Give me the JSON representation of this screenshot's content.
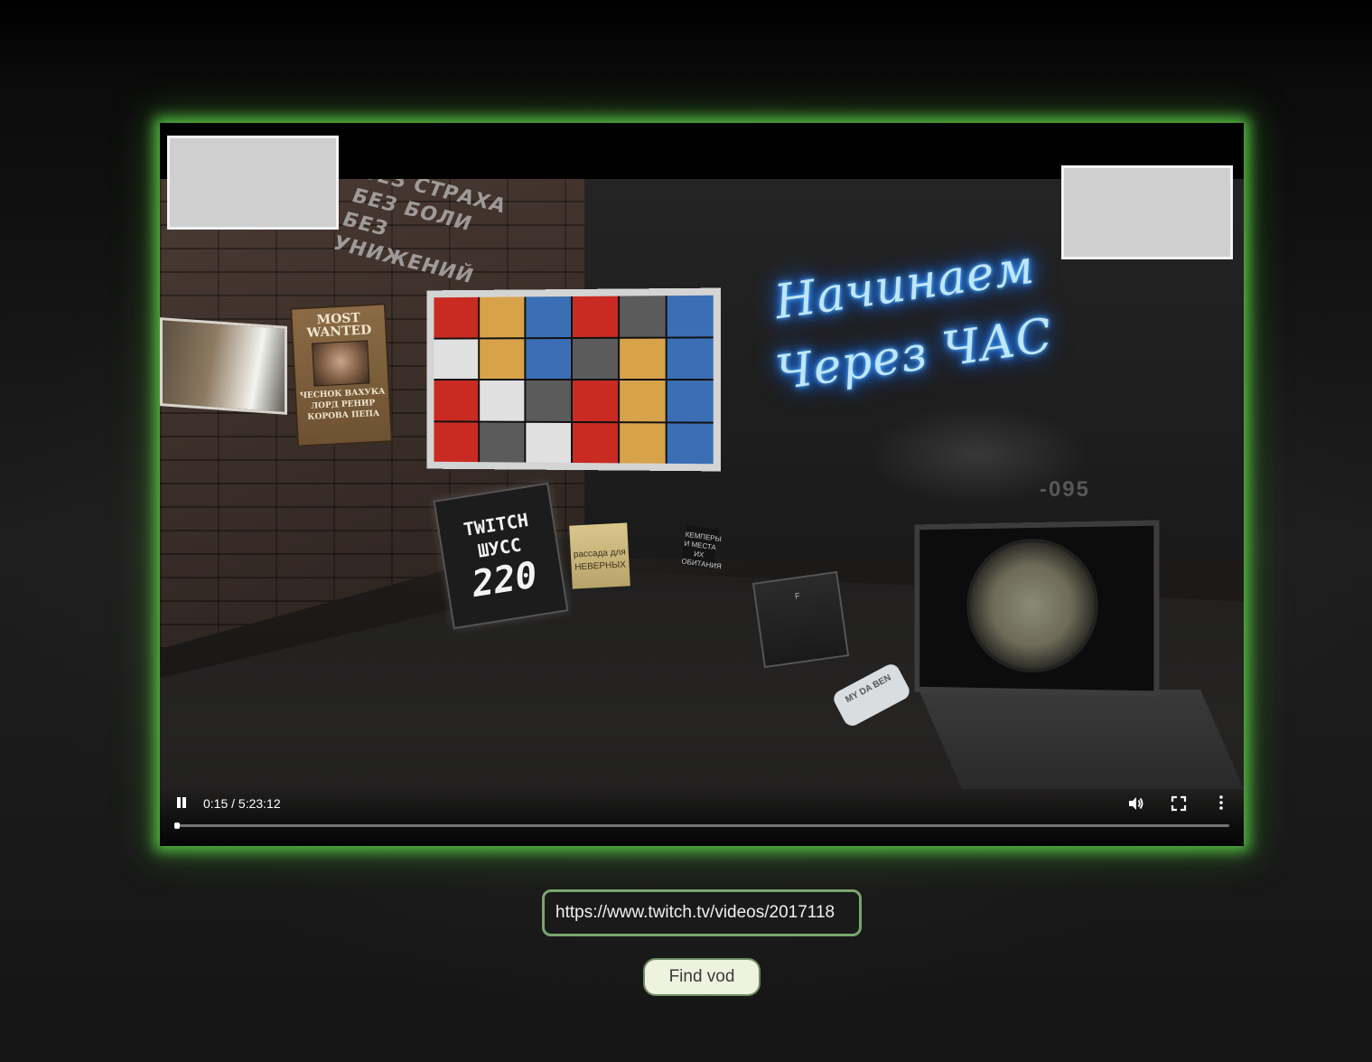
{
  "video": {
    "scene": {
      "graffiti_lines": [
        "БЕЗ СТРАХА",
        "БЕЗ БОЛИ",
        "БЕЗ УНИЖЕНИЙ"
      ],
      "wanted_poster": {
        "title_line1": "MOST",
        "title_line2": "WANTED",
        "name_line1": "ЧЕСНОК ВАХУКА",
        "name_line2": "ЛОРД РЕНИР",
        "name_line3": "КОРОВА ПЕПА"
      },
      "neon_sign": {
        "line1": "Начинаем",
        "line2": "Через ЧАС"
      },
      "twitch_box": {
        "line1": "TWITCH",
        "line2": "ШУСС",
        "line3": "220"
      },
      "crate_label": "рассада для НЕВЕРНЫХ",
      "small_sign": "КЕМПЕРЫ И МЕСТА ИХ ОБИТАНИЯ",
      "wolf_plate": "-095",
      "dog_tag": "MY DA BEN",
      "photo_card": "F"
    },
    "controls": {
      "play_state": "playing",
      "play_pause_icon": "pause-icon",
      "time_display": "0:15 / 5:23:12",
      "volume_icon": "volume-icon",
      "fullscreen_icon": "fullscreen-icon",
      "more_icon": "more-vert-icon",
      "progress_fraction": 0.0008
    },
    "glow_color": "#5acd46"
  },
  "form": {
    "url_value": "https://www.twitch.tv/videos/2017118",
    "find_button_label": "Find vod"
  }
}
